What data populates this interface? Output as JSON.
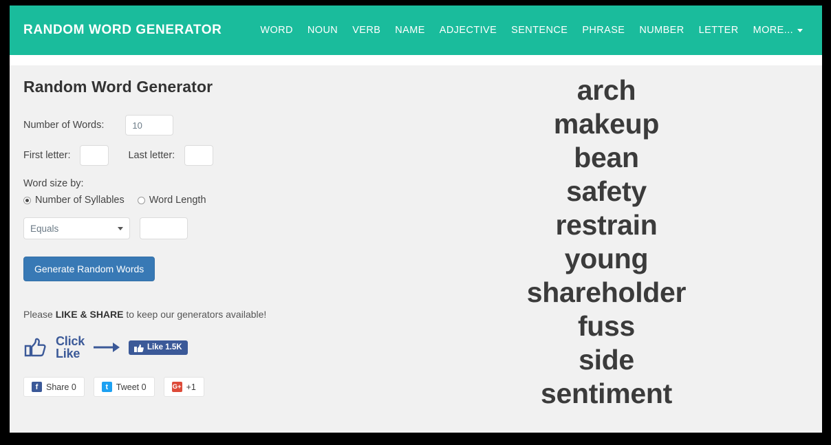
{
  "header": {
    "brand": "RANDOM WORD GENERATOR",
    "nav_items": [
      {
        "label": "WORD"
      },
      {
        "label": "NOUN"
      },
      {
        "label": "VERB"
      },
      {
        "label": "NAME"
      },
      {
        "label": "ADJECTIVE"
      },
      {
        "label": "SENTENCE"
      },
      {
        "label": "PHRASE"
      },
      {
        "label": "NUMBER"
      },
      {
        "label": "LETTER"
      }
    ],
    "more_label": "MORE...",
    "background_color": "#1abc9c"
  },
  "main": {
    "page_title": "Random Word Generator",
    "form": {
      "number_of_words_label": "Number of Words:",
      "number_of_words_value": "10",
      "first_letter_label": "First letter:",
      "first_letter_value": "",
      "last_letter_label": "Last letter:",
      "last_letter_value": "",
      "word_size_by_label": "Word size by:",
      "radio_syllables_label": "Number of Syllables",
      "radio_wordlength_label": "Word Length",
      "selected_radio": "Number of Syllables",
      "comparison_selected": "Equals",
      "comparison_options": [
        "Equals"
      ],
      "comparison_value": "",
      "generate_button_label": "Generate Random Words",
      "generate_button_color": "#3879b5"
    },
    "social": {
      "note_prefix": "Please ",
      "note_bold": "LIKE & SHARE",
      "note_suffix": " to keep our generators available!",
      "click_line1": "Click",
      "click_line2": "Like",
      "fb_like_label": "Like 1.5K",
      "share_buttons": [
        {
          "label": "Share 0",
          "icon": "facebook-icon",
          "icon_glyph": "f",
          "color": "#3b5998"
        },
        {
          "label": "Tweet 0",
          "icon": "twitter-icon",
          "icon_glyph": "t",
          "color": "#1da1f2"
        },
        {
          "label": "+1",
          "icon": "google-plus-icon",
          "icon_glyph": "G+",
          "color": "#dd4b39"
        }
      ]
    },
    "results": {
      "words": [
        "arch",
        "makeup",
        "bean",
        "safety",
        "restrain",
        "young",
        "shareholder",
        "fuss",
        "side",
        "sentiment"
      ]
    }
  }
}
